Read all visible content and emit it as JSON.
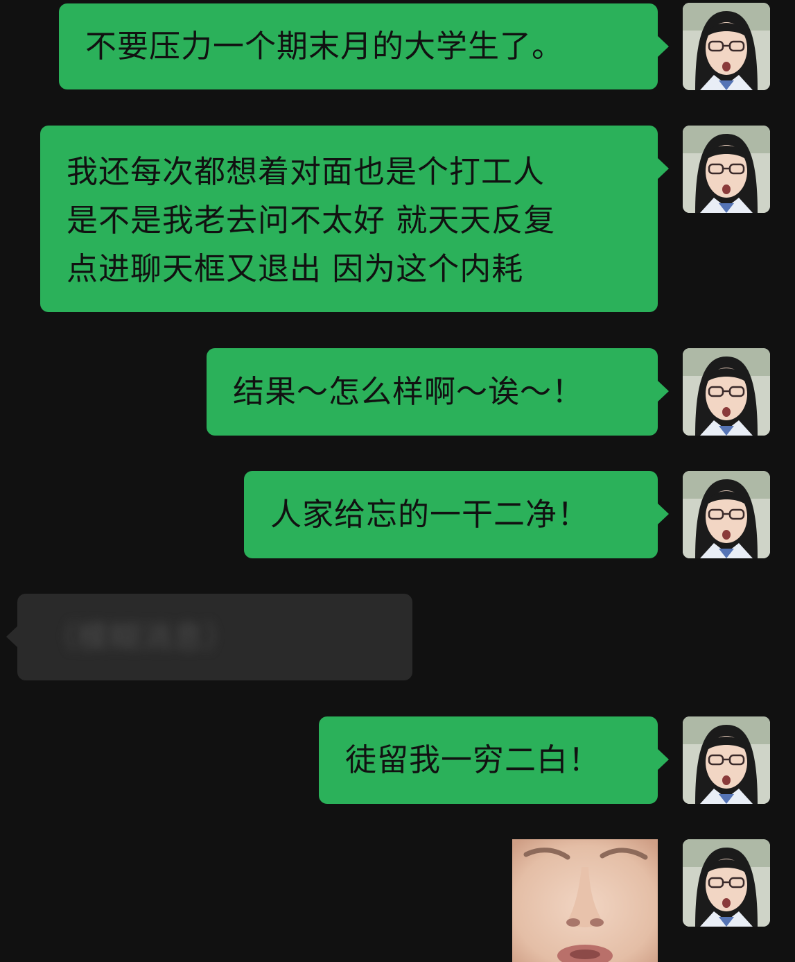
{
  "messages": [
    {
      "side": "out",
      "lines": [
        "不要压力一个期末月的大学生了。"
      ]
    },
    {
      "side": "out",
      "lines": [
        "我还每次都想着对面也是个打工人",
        "是不是我老去问不太好 就天天反复",
        "点进聊天框又退出 因为这个内耗"
      ]
    },
    {
      "side": "out",
      "lines": [
        "结果～怎么样啊～诶～！"
      ]
    },
    {
      "side": "out",
      "lines": [
        "人家给忘的一干二净！"
      ]
    },
    {
      "side": "in",
      "lines": [
        "（模糊消息）"
      ],
      "blurred": true
    },
    {
      "side": "out",
      "lines": [
        "徒留我一穷二白！"
      ]
    },
    {
      "side": "out",
      "type": "sticker",
      "icon": "face-sticker-image"
    }
  ],
  "colors": {
    "background": "#111111",
    "outgoing_bubble": "#2bb15a",
    "incoming_bubble": "#2a2a2a",
    "text": "#111111"
  },
  "avatar": {
    "icon": "user-avatar-girl-glasses"
  }
}
